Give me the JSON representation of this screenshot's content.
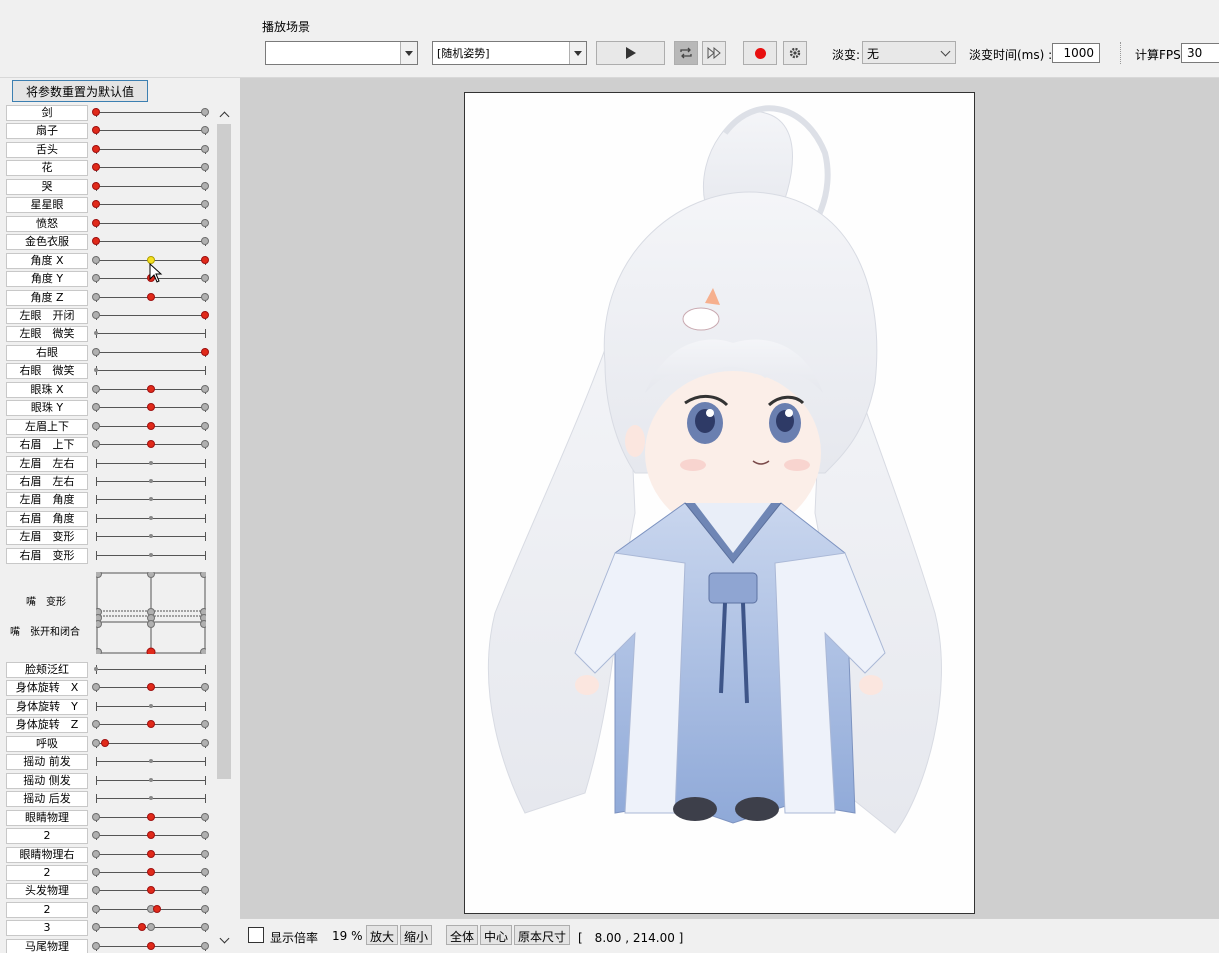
{
  "toolbar": {
    "section_title": "播放场景",
    "scene_value": "",
    "pose_value": "[随机姿势]",
    "fade_label": "淡变:",
    "fade_value": "无",
    "fade_time_label": "淡变时间(ms) :",
    "fade_time_value": "1000",
    "fps_label": "计算FPS",
    "fps_value": "30"
  },
  "left_panel": {
    "reset_label": "将参数重置为默认值",
    "params": [
      {
        "label": "剑",
        "knobs": [
          {
            "p": 0,
            "c": "red"
          },
          {
            "p": 1,
            "c": "gray"
          }
        ]
      },
      {
        "label": "扇子",
        "knobs": [
          {
            "p": 0,
            "c": "red"
          },
          {
            "p": 1,
            "c": "gray"
          }
        ]
      },
      {
        "label": "舌头",
        "knobs": [
          {
            "p": 0,
            "c": "red"
          },
          {
            "p": 1,
            "c": "gray"
          }
        ]
      },
      {
        "label": "花",
        "knobs": [
          {
            "p": 0,
            "c": "red"
          },
          {
            "p": 1,
            "c": "gray"
          }
        ]
      },
      {
        "label": "哭",
        "knobs": [
          {
            "p": 0,
            "c": "red"
          },
          {
            "p": 1,
            "c": "gray"
          }
        ]
      },
      {
        "label": "星星眼",
        "knobs": [
          {
            "p": 0,
            "c": "red"
          },
          {
            "p": 1,
            "c": "gray"
          }
        ]
      },
      {
        "label": "愤怒",
        "knobs": [
          {
            "p": 0,
            "c": "red"
          },
          {
            "p": 1,
            "c": "gray"
          }
        ]
      },
      {
        "label": "金色衣服",
        "knobs": [
          {
            "p": 0,
            "c": "red"
          },
          {
            "p": 1,
            "c": "gray"
          }
        ]
      },
      {
        "label": "角度 X",
        "knobs": [
          {
            "p": 0,
            "c": "gray"
          },
          {
            "p": 0.5,
            "c": "yellow"
          },
          {
            "p": 1,
            "c": "red"
          }
        ]
      },
      {
        "label": "角度 Y",
        "knobs": [
          {
            "p": 0,
            "c": "gray"
          },
          {
            "p": 0.5,
            "c": "red"
          },
          {
            "p": 1,
            "c": "gray"
          }
        ]
      },
      {
        "label": "角度 Z",
        "knobs": [
          {
            "p": 0,
            "c": "gray"
          },
          {
            "p": 0.5,
            "c": "red"
          },
          {
            "p": 1,
            "c": "gray"
          }
        ]
      },
      {
        "label": "左眼　开闭",
        "knobs": [
          {
            "p": 0,
            "c": "gray"
          },
          {
            "p": 1,
            "c": "red"
          }
        ]
      },
      {
        "label": "左眼　微笑",
        "knobs": [
          {
            "p": 0,
            "c": "small"
          }
        ]
      },
      {
        "label": "右眼",
        "knobs": [
          {
            "p": 0,
            "c": "gray"
          },
          {
            "p": 1,
            "c": "red"
          }
        ]
      },
      {
        "label": "右眼　微笑",
        "knobs": [
          {
            "p": 0,
            "c": "small"
          }
        ]
      },
      {
        "label": "眼珠 X",
        "knobs": [
          {
            "p": 0,
            "c": "gray"
          },
          {
            "p": 0.5,
            "c": "red"
          },
          {
            "p": 1,
            "c": "gray"
          }
        ]
      },
      {
        "label": "眼珠 Y",
        "knobs": [
          {
            "p": 0,
            "c": "gray"
          },
          {
            "p": 0.5,
            "c": "red"
          },
          {
            "p": 1,
            "c": "gray"
          }
        ]
      },
      {
        "label": "左眉上下",
        "knobs": [
          {
            "p": 0,
            "c": "gray"
          },
          {
            "p": 0.5,
            "c": "red"
          },
          {
            "p": 1,
            "c": "gray"
          }
        ]
      },
      {
        "label": "右眉　上下",
        "knobs": [
          {
            "p": 0,
            "c": "gray"
          },
          {
            "p": 0.5,
            "c": "red"
          },
          {
            "p": 1,
            "c": "gray"
          }
        ]
      },
      {
        "label": "左眉　左右",
        "knobs": [
          {
            "p": 0.5,
            "c": "small"
          }
        ]
      },
      {
        "label": "右眉　左右",
        "knobs": [
          {
            "p": 0.5,
            "c": "small"
          }
        ]
      },
      {
        "label": "左眉　角度",
        "knobs": [
          {
            "p": 0.5,
            "c": "small"
          }
        ]
      },
      {
        "label": "右眉　角度",
        "knobs": [
          {
            "p": 0.5,
            "c": "small"
          }
        ]
      },
      {
        "label": "左眉　变形",
        "knobs": [
          {
            "p": 0.5,
            "c": "small"
          }
        ]
      },
      {
        "label": "右眉　变形",
        "knobs": [
          {
            "p": 0.5,
            "c": "small"
          }
        ]
      }
    ],
    "mouth_labels": [
      "嘴　变形",
      "嘴　张开和闭合"
    ],
    "params2": [
      {
        "label": "脸颊泛红",
        "knobs": [
          {
            "p": 0,
            "c": "small"
          }
        ]
      },
      {
        "label": "身体旋转　X",
        "knobs": [
          {
            "p": 0,
            "c": "gray"
          },
          {
            "p": 0.5,
            "c": "red"
          },
          {
            "p": 1,
            "c": "gray"
          }
        ]
      },
      {
        "label": "身体旋转　Y",
        "knobs": [
          {
            "p": 0.5,
            "c": "small"
          }
        ]
      },
      {
        "label": "身体旋转　Z",
        "knobs": [
          {
            "p": 0,
            "c": "gray"
          },
          {
            "p": 0.5,
            "c": "red"
          },
          {
            "p": 1,
            "c": "gray"
          }
        ]
      },
      {
        "label": "呼吸",
        "knobs": [
          {
            "p": 0,
            "c": "gray"
          },
          {
            "p": 0.08,
            "c": "red"
          },
          {
            "p": 1,
            "c": "gray"
          }
        ]
      },
      {
        "label": "摇动 前发",
        "knobs": [
          {
            "p": 0.5,
            "c": "small"
          }
        ]
      },
      {
        "label": "摇动 侧发",
        "knobs": [
          {
            "p": 0.5,
            "c": "small"
          }
        ]
      },
      {
        "label": "摇动 后发",
        "knobs": [
          {
            "p": 0.5,
            "c": "small"
          }
        ]
      },
      {
        "label": "眼睛物理",
        "knobs": [
          {
            "p": 0,
            "c": "gray"
          },
          {
            "p": 0.5,
            "c": "red"
          },
          {
            "p": 1,
            "c": "gray"
          }
        ]
      },
      {
        "label": "2",
        "knobs": [
          {
            "p": 0,
            "c": "gray"
          },
          {
            "p": 0.5,
            "c": "red"
          },
          {
            "p": 1,
            "c": "gray"
          }
        ]
      },
      {
        "label": "眼睛物理右",
        "knobs": [
          {
            "p": 0,
            "c": "gray"
          },
          {
            "p": 0.5,
            "c": "red"
          },
          {
            "p": 1,
            "c": "gray"
          }
        ]
      },
      {
        "label": "2",
        "knobs": [
          {
            "p": 0,
            "c": "gray"
          },
          {
            "p": 0.5,
            "c": "red"
          },
          {
            "p": 1,
            "c": "gray"
          }
        ]
      },
      {
        "label": "头发物理",
        "knobs": [
          {
            "p": 0,
            "c": "gray"
          },
          {
            "p": 0.5,
            "c": "red"
          },
          {
            "p": 1,
            "c": "gray"
          }
        ]
      },
      {
        "label": "2",
        "knobs": [
          {
            "p": 0,
            "c": "gray"
          },
          {
            "p": 0.5,
            "c": "gray"
          },
          {
            "p": 0.56,
            "c": "red"
          },
          {
            "p": 1,
            "c": "gray"
          }
        ]
      },
      {
        "label": "3",
        "knobs": [
          {
            "p": 0,
            "c": "gray"
          },
          {
            "p": 0.42,
            "c": "red"
          },
          {
            "p": 0.5,
            "c": "gray"
          },
          {
            "p": 1,
            "c": "gray"
          }
        ]
      },
      {
        "label": "马尾物理",
        "knobs": [
          {
            "p": 0,
            "c": "gray"
          },
          {
            "p": 0.5,
            "c": "red"
          },
          {
            "p": 1,
            "c": "gray"
          }
        ]
      }
    ]
  },
  "status": {
    "show_zoom_label": "显示倍率",
    "zoom_value": "19 %",
    "zoom_in": "放大",
    "zoom_out": "缩小",
    "fit_all": "全体",
    "center": "中心",
    "original_size": "原本尺寸",
    "coords": "[　8.00 ,  214.00 ]"
  },
  "colors": {
    "knob_red": "#e02a1a",
    "knob_yellow": "#f4e020",
    "canvas_bg": "#cfcfcf"
  }
}
